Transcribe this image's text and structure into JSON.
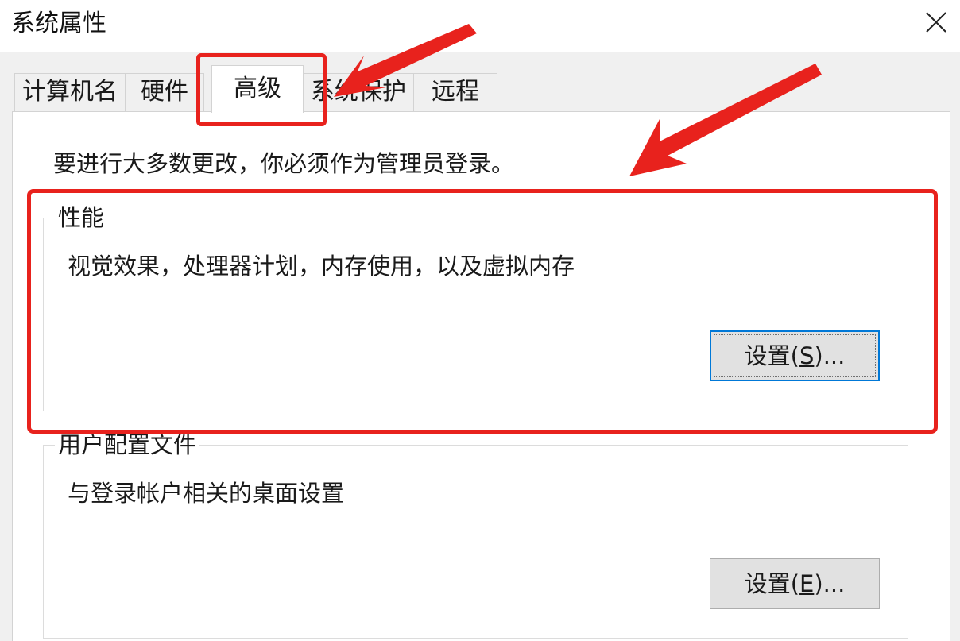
{
  "window": {
    "title": "系统属性"
  },
  "tabs": [
    {
      "label": "计算机名"
    },
    {
      "label": "硬件"
    },
    {
      "label": "高级"
    },
    {
      "label": "系统保护"
    },
    {
      "label": "远程"
    }
  ],
  "active_tab": "高级",
  "advanced": {
    "admin_note": "要进行大多数更改，你必须作为管理员登录。",
    "performance": {
      "title": "性能",
      "description": "视觉效果，处理器计划，内存使用，以及虚拟内存",
      "button_prefix": "设置(",
      "button_mnemonic": "S",
      "button_suffix": ")..."
    },
    "user_profiles": {
      "title": "用户配置文件",
      "description": "与登录帐户相关的桌面设置",
      "button_prefix": "设置(",
      "button_mnemonic": "E",
      "button_suffix": ")..."
    }
  },
  "colors": {
    "annotation_red": "#e8221d",
    "focus_blue": "#0078d7"
  },
  "icons": {
    "close": "close-icon"
  }
}
